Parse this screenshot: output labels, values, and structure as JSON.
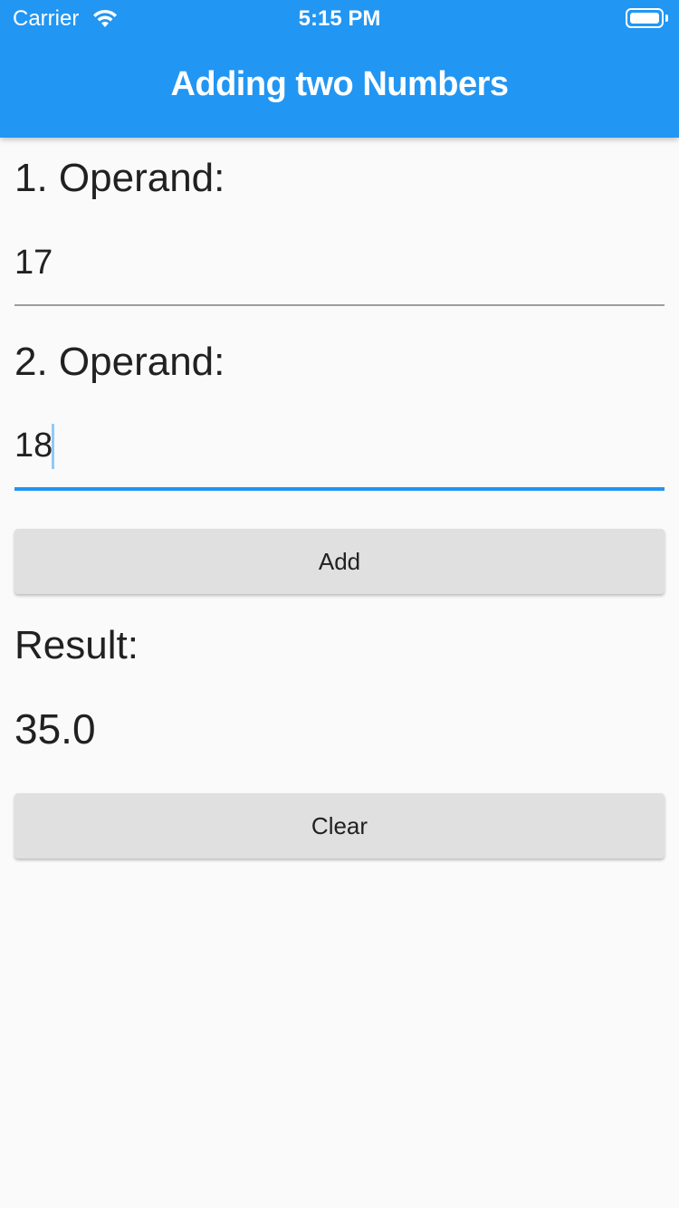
{
  "status_bar": {
    "carrier": "Carrier",
    "time": "5:15 PM",
    "wifi_icon": "wifi-icon",
    "battery_icon": "battery-icon"
  },
  "app_bar": {
    "title": "Adding two Numbers",
    "color": "#2196f3"
  },
  "form": {
    "operand1": {
      "label": "1. Operand:",
      "value": "17"
    },
    "operand2": {
      "label": "2. Operand:",
      "value": "18"
    },
    "add_label": "Add",
    "result_label": "Result:",
    "result_value": "35.0",
    "clear_label": "Clear"
  }
}
